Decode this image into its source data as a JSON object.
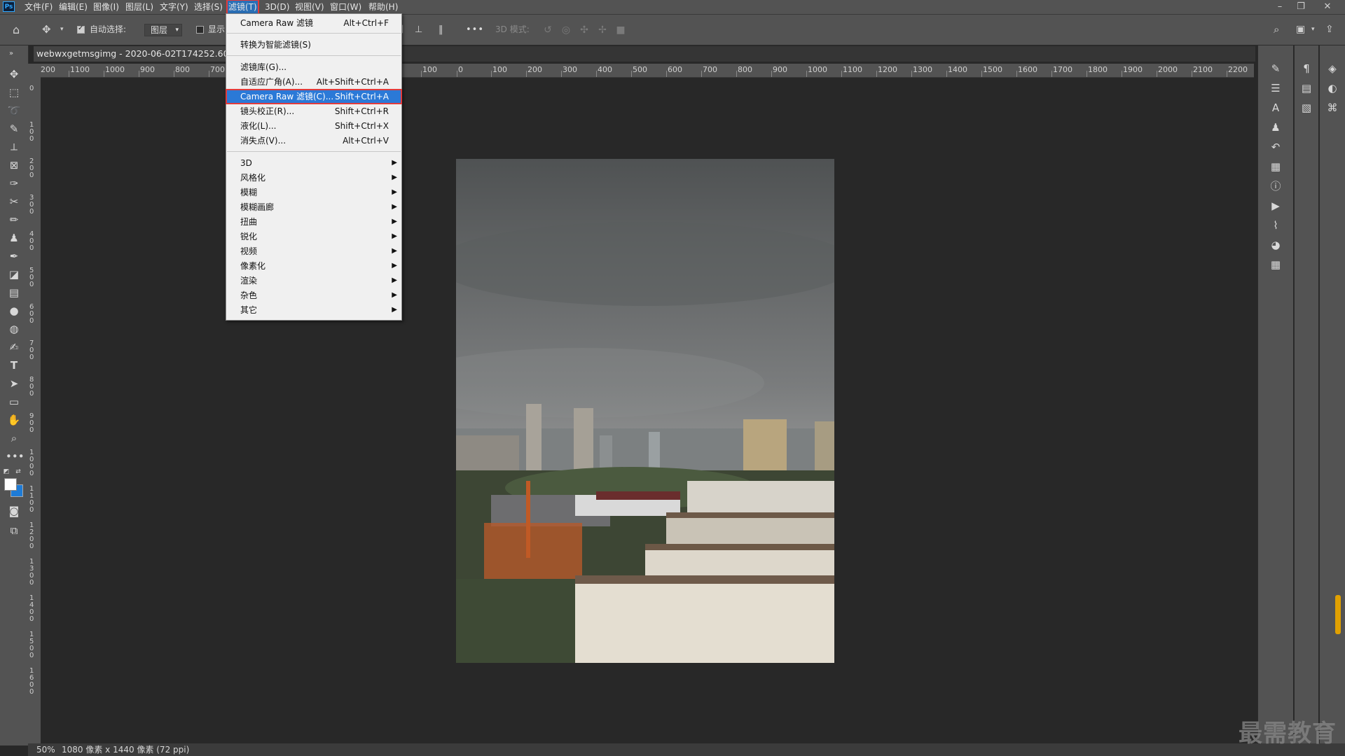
{
  "menubar": {
    "logo": "Ps",
    "items": [
      "文件(F)",
      "编辑(E)",
      "图像(I)",
      "图层(L)",
      "文字(Y)",
      "选择(S)",
      "滤镜(T)",
      "3D(D)",
      "视图(V)",
      "窗口(W)",
      "帮助(H)"
    ],
    "active_index": 6,
    "window_controls": [
      "minimize",
      "restore",
      "close"
    ]
  },
  "options_bar": {
    "auto_select_label": "自动选择:",
    "auto_select_checked": true,
    "target_select": "图层",
    "show_label": "显示",
    "show_checked": false,
    "more_label": "•••",
    "mode_3d_label": "3D 模式:"
  },
  "document": {
    "tab_title": "webwxgetmsgimg - 2020-06-02T174252.600.jpg"
  },
  "ruler": {
    "h_labels": [
      "200",
      "1100",
      "1000",
      "900",
      "800",
      "700",
      "100",
      "0",
      "100",
      "200",
      "300",
      "400",
      "500",
      "600",
      "700",
      "800",
      "900",
      "1000",
      "1100",
      "1200",
      "1300",
      "1400",
      "1500",
      "1600",
      "1700",
      "1800",
      "1900",
      "2000",
      "2100",
      "2200"
    ],
    "v_labels": [
      "0",
      "1 0 0",
      "2 0 0",
      "3 0 0",
      "4 0 0",
      "5 0 0",
      "6 0 0",
      "7 0 0",
      "8 0 0",
      "9 0 0",
      "1 0 0 0",
      "1 1 0 0",
      "1 2 0 0",
      "1 3 0 0",
      "1 4 0 0",
      "1 5 0 0",
      "1 6 0 0"
    ]
  },
  "filter_menu": {
    "items": [
      {
        "label": "Camera Raw 滤镜",
        "shortcut": "Alt+Ctrl+F"
      },
      {
        "label": "转换为智能滤镜(S)",
        "shortcut": ""
      },
      {
        "label": "滤镜库(G)...",
        "shortcut": ""
      },
      {
        "label": "自适应广角(A)...",
        "shortcut": "Alt+Shift+Ctrl+A"
      },
      {
        "label": "Camera Raw 滤镜(C)...",
        "shortcut": "Shift+Ctrl+A"
      },
      {
        "label": "镜头校正(R)...",
        "shortcut": "Shift+Ctrl+R"
      },
      {
        "label": "液化(L)...",
        "shortcut": "Shift+Ctrl+X"
      },
      {
        "label": "消失点(V)...",
        "shortcut": "Alt+Ctrl+V"
      }
    ],
    "highlighted_index": 4,
    "submenus": [
      "3D",
      "风格化",
      "模糊",
      "模糊画廊",
      "扭曲",
      "锐化",
      "视频",
      "像素化",
      "渲染",
      "杂色",
      "其它"
    ]
  },
  "status_bar": {
    "zoom": "50%",
    "info": "1080 像素 x 1440 像素 (72 ppi)"
  },
  "watermark": "最需教育",
  "colors": {
    "accent_blue": "#2b79d7",
    "highlight_red": "#e23b3b",
    "panel_gray": "#535353",
    "canvas_bg": "#282828"
  }
}
